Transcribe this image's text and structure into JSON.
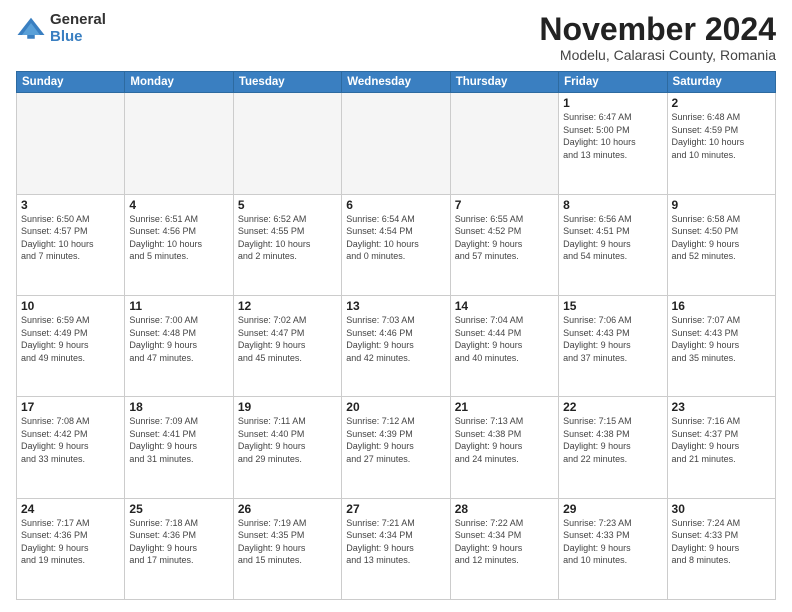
{
  "logo": {
    "general": "General",
    "blue": "Blue"
  },
  "header": {
    "month_title": "November 2024",
    "subtitle": "Modelu, Calarasi County, Romania"
  },
  "days_of_week": [
    "Sunday",
    "Monday",
    "Tuesday",
    "Wednesday",
    "Thursday",
    "Friday",
    "Saturday"
  ],
  "weeks": [
    [
      {
        "day": "",
        "detail": ""
      },
      {
        "day": "",
        "detail": ""
      },
      {
        "day": "",
        "detail": ""
      },
      {
        "day": "",
        "detail": ""
      },
      {
        "day": "",
        "detail": ""
      },
      {
        "day": "1",
        "detail": "Sunrise: 6:47 AM\nSunset: 5:00 PM\nDaylight: 10 hours\nand 13 minutes."
      },
      {
        "day": "2",
        "detail": "Sunrise: 6:48 AM\nSunset: 4:59 PM\nDaylight: 10 hours\nand 10 minutes."
      }
    ],
    [
      {
        "day": "3",
        "detail": "Sunrise: 6:50 AM\nSunset: 4:57 PM\nDaylight: 10 hours\nand 7 minutes."
      },
      {
        "day": "4",
        "detail": "Sunrise: 6:51 AM\nSunset: 4:56 PM\nDaylight: 10 hours\nand 5 minutes."
      },
      {
        "day": "5",
        "detail": "Sunrise: 6:52 AM\nSunset: 4:55 PM\nDaylight: 10 hours\nand 2 minutes."
      },
      {
        "day": "6",
        "detail": "Sunrise: 6:54 AM\nSunset: 4:54 PM\nDaylight: 10 hours\nand 0 minutes."
      },
      {
        "day": "7",
        "detail": "Sunrise: 6:55 AM\nSunset: 4:52 PM\nDaylight: 9 hours\nand 57 minutes."
      },
      {
        "day": "8",
        "detail": "Sunrise: 6:56 AM\nSunset: 4:51 PM\nDaylight: 9 hours\nand 54 minutes."
      },
      {
        "day": "9",
        "detail": "Sunrise: 6:58 AM\nSunset: 4:50 PM\nDaylight: 9 hours\nand 52 minutes."
      }
    ],
    [
      {
        "day": "10",
        "detail": "Sunrise: 6:59 AM\nSunset: 4:49 PM\nDaylight: 9 hours\nand 49 minutes."
      },
      {
        "day": "11",
        "detail": "Sunrise: 7:00 AM\nSunset: 4:48 PM\nDaylight: 9 hours\nand 47 minutes."
      },
      {
        "day": "12",
        "detail": "Sunrise: 7:02 AM\nSunset: 4:47 PM\nDaylight: 9 hours\nand 45 minutes."
      },
      {
        "day": "13",
        "detail": "Sunrise: 7:03 AM\nSunset: 4:46 PM\nDaylight: 9 hours\nand 42 minutes."
      },
      {
        "day": "14",
        "detail": "Sunrise: 7:04 AM\nSunset: 4:44 PM\nDaylight: 9 hours\nand 40 minutes."
      },
      {
        "day": "15",
        "detail": "Sunrise: 7:06 AM\nSunset: 4:43 PM\nDaylight: 9 hours\nand 37 minutes."
      },
      {
        "day": "16",
        "detail": "Sunrise: 7:07 AM\nSunset: 4:43 PM\nDaylight: 9 hours\nand 35 minutes."
      }
    ],
    [
      {
        "day": "17",
        "detail": "Sunrise: 7:08 AM\nSunset: 4:42 PM\nDaylight: 9 hours\nand 33 minutes."
      },
      {
        "day": "18",
        "detail": "Sunrise: 7:09 AM\nSunset: 4:41 PM\nDaylight: 9 hours\nand 31 minutes."
      },
      {
        "day": "19",
        "detail": "Sunrise: 7:11 AM\nSunset: 4:40 PM\nDaylight: 9 hours\nand 29 minutes."
      },
      {
        "day": "20",
        "detail": "Sunrise: 7:12 AM\nSunset: 4:39 PM\nDaylight: 9 hours\nand 27 minutes."
      },
      {
        "day": "21",
        "detail": "Sunrise: 7:13 AM\nSunset: 4:38 PM\nDaylight: 9 hours\nand 24 minutes."
      },
      {
        "day": "22",
        "detail": "Sunrise: 7:15 AM\nSunset: 4:38 PM\nDaylight: 9 hours\nand 22 minutes."
      },
      {
        "day": "23",
        "detail": "Sunrise: 7:16 AM\nSunset: 4:37 PM\nDaylight: 9 hours\nand 21 minutes."
      }
    ],
    [
      {
        "day": "24",
        "detail": "Sunrise: 7:17 AM\nSunset: 4:36 PM\nDaylight: 9 hours\nand 19 minutes."
      },
      {
        "day": "25",
        "detail": "Sunrise: 7:18 AM\nSunset: 4:36 PM\nDaylight: 9 hours\nand 17 minutes."
      },
      {
        "day": "26",
        "detail": "Sunrise: 7:19 AM\nSunset: 4:35 PM\nDaylight: 9 hours\nand 15 minutes."
      },
      {
        "day": "27",
        "detail": "Sunrise: 7:21 AM\nSunset: 4:34 PM\nDaylight: 9 hours\nand 13 minutes."
      },
      {
        "day": "28",
        "detail": "Sunrise: 7:22 AM\nSunset: 4:34 PM\nDaylight: 9 hours\nand 12 minutes."
      },
      {
        "day": "29",
        "detail": "Sunrise: 7:23 AM\nSunset: 4:33 PM\nDaylight: 9 hours\nand 10 minutes."
      },
      {
        "day": "30",
        "detail": "Sunrise: 7:24 AM\nSunset: 4:33 PM\nDaylight: 9 hours\nand 8 minutes."
      }
    ]
  ]
}
